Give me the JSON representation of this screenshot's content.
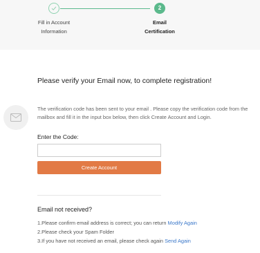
{
  "steps": [
    {
      "line1": "Fill in Account",
      "line2": "Information",
      "state": "done",
      "icon": "check-icon"
    },
    {
      "number": "2",
      "line1": "Email",
      "line2": "Certification",
      "state": "active"
    }
  ],
  "main": {
    "heading": "Please verify your Email now, to complete registration!",
    "info": {
      "part1": "The verification code has been sent to your email",
      "email": "",
      "part2": " . Please copy the verification code from the mailbox and fill it in the input box below, then click Create Account and Login."
    },
    "code_label": "Enter the Code:",
    "code_value": "",
    "create_button": "Create Account"
  },
  "help": {
    "title": "Email not received?",
    "line1_text": "1.Please confirm email address is correct; you can return ",
    "line1_link": "Modify Again",
    "line2_text": "2.Please check your Spam Folder",
    "line3_text": "3.If you have not received an email, please check again ",
    "line3_link": "Send Again"
  },
  "colors": {
    "accent_green": "#5bb98c",
    "button_orange": "#e27a45",
    "link_blue": "#3a77c9"
  }
}
